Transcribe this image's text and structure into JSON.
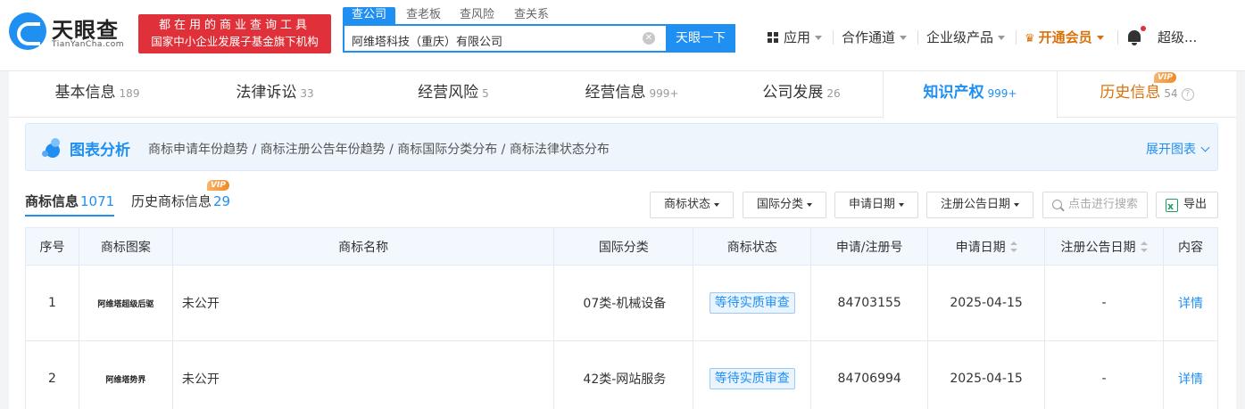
{
  "brand": {
    "name": "天眼查",
    "domain": "TianYanCha.com",
    "promo_line1": "都在用的商业查询工具",
    "promo_line2": "国家中小企业发展子基金旗下机构"
  },
  "search": {
    "tabs": [
      "查公司",
      "查老板",
      "查风险",
      "查关系"
    ],
    "active_tab": "查公司",
    "value": "阿维塔科技（重庆）有限公司",
    "button_label": "天眼一下"
  },
  "topnav": {
    "apps": "应用",
    "partner": "合作通道",
    "enterprise": "企业级产品",
    "vip": "开通会员",
    "user": "超级..."
  },
  "tabs": [
    {
      "label": "基本信息",
      "count": "189"
    },
    {
      "label": "法律诉讼",
      "count": "33"
    },
    {
      "label": "经营风险",
      "count": "5"
    },
    {
      "label": "经营信息",
      "count": "999+"
    },
    {
      "label": "公司发展",
      "count": "26"
    },
    {
      "label": "知识产权",
      "count": "999+"
    },
    {
      "label": "历史信息",
      "count": "54"
    }
  ],
  "active_tab": "知识产权",
  "vip_badge": "VIP",
  "chart_bar": {
    "title": "图表分析",
    "links": "商标申请年份趋势 / 商标注册公告年份趋势 / 商标国际分类分布 / 商标法律状态分布",
    "expand": "展开图表"
  },
  "subtabs": [
    {
      "label": "商标信息",
      "count": "1071"
    },
    {
      "label": "历史商标信息",
      "count": "29"
    }
  ],
  "filters": [
    "商标状态",
    "国际分类",
    "申请日期",
    "注册公告日期"
  ],
  "search_placeholder": "点击进行搜索",
  "export_label": "导出",
  "table": {
    "headers": [
      "序号",
      "商标图案",
      "商标名称",
      "国际分类",
      "商标状态",
      "申请/注册号",
      "申请日期",
      "注册公告日期",
      "内容"
    ],
    "rows": [
      {
        "no": "1",
        "image_text": "阿维塔超级后驱",
        "name": "未公开",
        "class": "07类-机械设备",
        "status": "等待实质审查",
        "reg_no": "84703155",
        "apply_date": "2025-04-15",
        "pub_date": "-",
        "action": "详情"
      },
      {
        "no": "2",
        "image_text": "阿维塔势界",
        "name": "未公开",
        "class": "42类-网站服务",
        "status": "等待实质审查",
        "reg_no": "84706994",
        "apply_date": "2025-04-15",
        "pub_date": "-",
        "action": "详情"
      }
    ]
  },
  "colors": {
    "accent": "#1f8ff2",
    "promo": "#e0313a",
    "vip": "#d9720b"
  }
}
